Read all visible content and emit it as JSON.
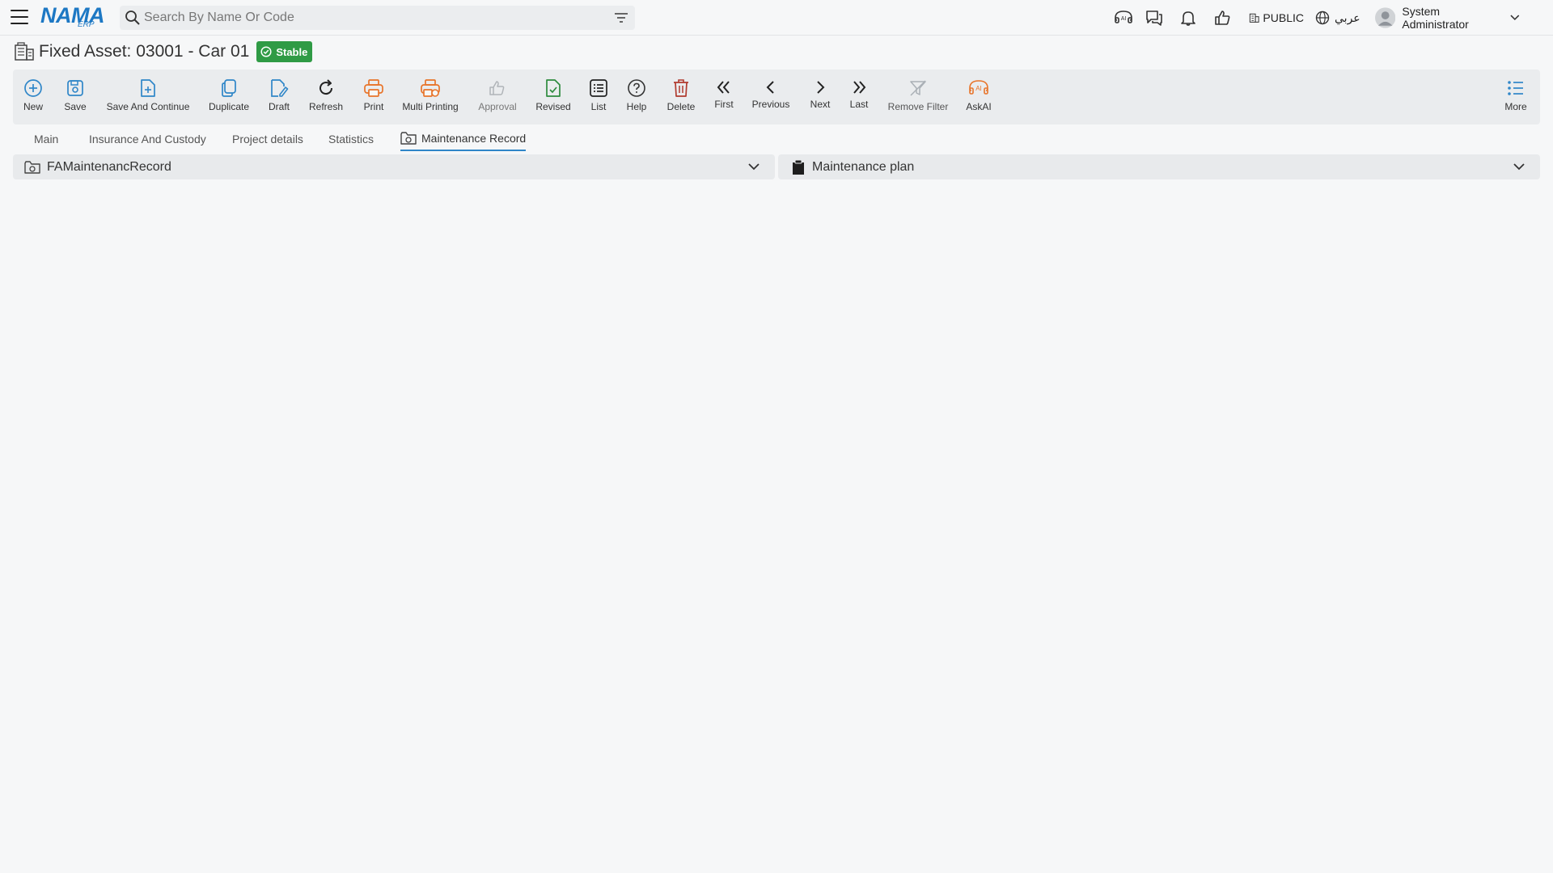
{
  "header": {
    "logo_text": "NAMA",
    "logo_sub": "ERP",
    "search_placeholder": "Search By Name Or Code",
    "icons": [
      "ai-icon",
      "chat-icon",
      "bell-icon",
      "thumbs-up-icon"
    ],
    "branch_label": "PUBLIC",
    "language_label": "عربي",
    "user_name": "System Administrator"
  },
  "page": {
    "title": "Fixed Asset: 03001 - Car 01",
    "status_badge": "Stable",
    "status_color": "#2f9b45"
  },
  "toolbar": {
    "new": "New",
    "save": "Save",
    "save_continue": "Save And Continue",
    "duplicate": "Duplicate",
    "draft": "Draft",
    "refresh": "Refresh",
    "print": "Print",
    "multi_printing": "Multi Printing",
    "approval": "Approval",
    "revised": "Revised",
    "list": "List",
    "help": "Help",
    "delete": "Delete",
    "first": "First",
    "previous": "Previous",
    "next": "Next",
    "last": "Last",
    "remove_filter": "Remove Filter",
    "ask_ai": "AskAI",
    "more": "More"
  },
  "tabs": [
    {
      "label": "Main",
      "active": false
    },
    {
      "label": "Insurance And Custody",
      "active": false
    },
    {
      "label": "Project details",
      "active": false
    },
    {
      "label": "Statistics",
      "active": false
    },
    {
      "label": "Maintenance Record",
      "active": true
    }
  ],
  "panels": [
    {
      "title": "FAMaintenancRecord",
      "expanded": false
    },
    {
      "title": "Maintenance plan",
      "expanded": false
    }
  ],
  "colors": {
    "accent_blue": "#2f86c8",
    "print_orange": "#e8742a",
    "revised_green": "#2e8b3e",
    "delete_red": "#b03a2e"
  }
}
